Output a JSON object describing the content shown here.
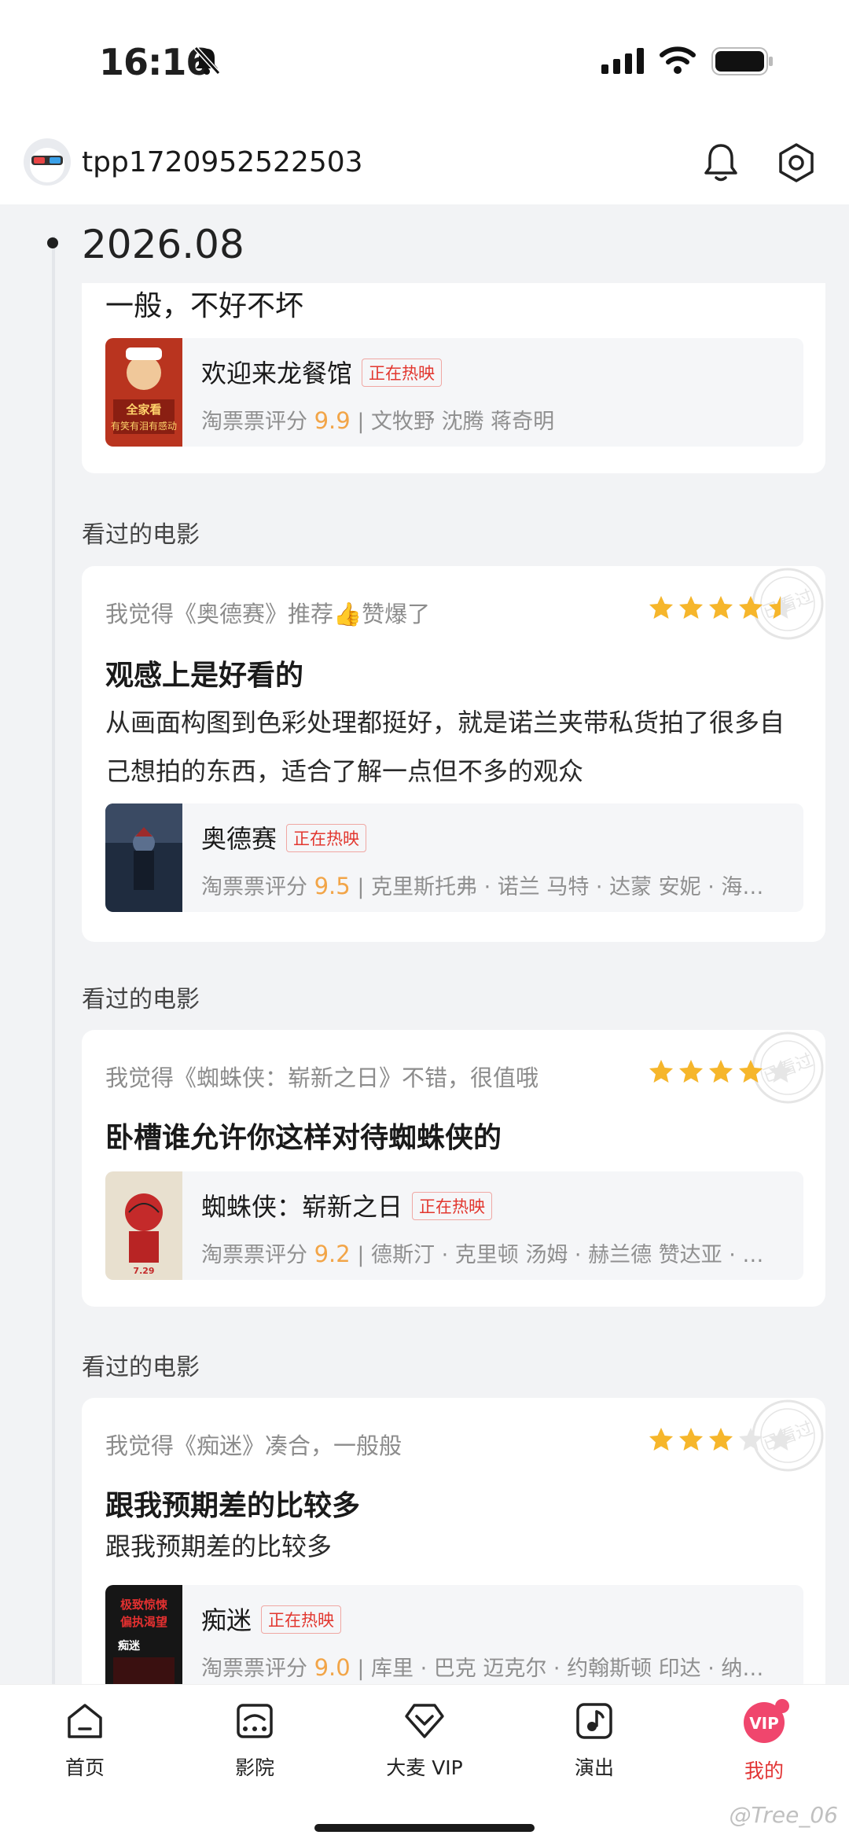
{
  "status_bar": {
    "time": "16:16"
  },
  "header": {
    "username": "tpp1720952522503"
  },
  "timeline": {
    "date": "2026.08"
  },
  "cards": [
    {
      "review_title": "一般，不好不坏",
      "movie": {
        "title": "欢迎来龙餐馆",
        "badge": "正在热映",
        "rating_label": "淘票票评分",
        "score": "9.9",
        "cast": "| 文牧野 沈腾 蒋奇明",
        "poster_text": "全家看\n有笑有泪有感动"
      }
    },
    {
      "section_label": "看过的电影",
      "head": "我觉得《奥德赛》推荐👍赞爆了",
      "rating": 4.5,
      "review_title": "观感上是好看的",
      "review_body": "从画面构图到色彩处理都挺好，就是诺兰夹带私货拍了很多自己想拍的东西，适合了解一点但不多的观众",
      "movie": {
        "title": "奥德赛",
        "badge": "正在热映",
        "rating_label": "淘票票评分",
        "score": "9.5",
        "cast": "| 克里斯托弗 · 诺兰 马特 · 达蒙 安妮 · 海瑟薇"
      }
    },
    {
      "section_label": "看过的电影",
      "head": "我觉得《蜘蛛侠：崭新之日》不错，很值哦",
      "rating": 4,
      "review_title": "卧槽谁允许你这样对待蜘蛛侠的",
      "movie": {
        "title": "蜘蛛侠：崭新之日",
        "badge": "正在热映",
        "rating_label": "淘票票评分",
        "score": "9.2",
        "cast": "| 德斯汀 · 克里顿 汤姆 · 赫兰德 赞达亚 · 科尔曼",
        "poster_text": "7.29"
      }
    },
    {
      "section_label": "看过的电影",
      "head": "我觉得《痴迷》凑合，一般般",
      "rating": 3,
      "review_title": "跟我预期差的比较多",
      "review_body": "跟我预期差的比较多",
      "movie": {
        "title": "痴迷",
        "badge": "正在热映",
        "rating_label": "淘票票评分",
        "score": "9.0",
        "cast": "| 库里 · 巴克 迈克尔 · 约翰斯顿 印达 · 纳瓦雷特",
        "poster_text": "极致惊悚\n偏执渴望\n痴迷"
      }
    }
  ],
  "stamp_text": "已看过",
  "nav": [
    {
      "label": "首页",
      "icon": "home-icon"
    },
    {
      "label": "影院",
      "icon": "cinema-icon"
    },
    {
      "label": "大麦 VIP",
      "icon": "diamond-icon"
    },
    {
      "label": "演出",
      "icon": "music-note-icon"
    },
    {
      "label": "我的",
      "icon": "vip-avatar-icon",
      "active": true,
      "badge_icon_text": "VIP"
    }
  ],
  "watermark": "@Tree_06",
  "colors": {
    "accent": "#e23535",
    "score": "#f2a548",
    "star": "#f6b62b",
    "badge": "#e2372f"
  }
}
